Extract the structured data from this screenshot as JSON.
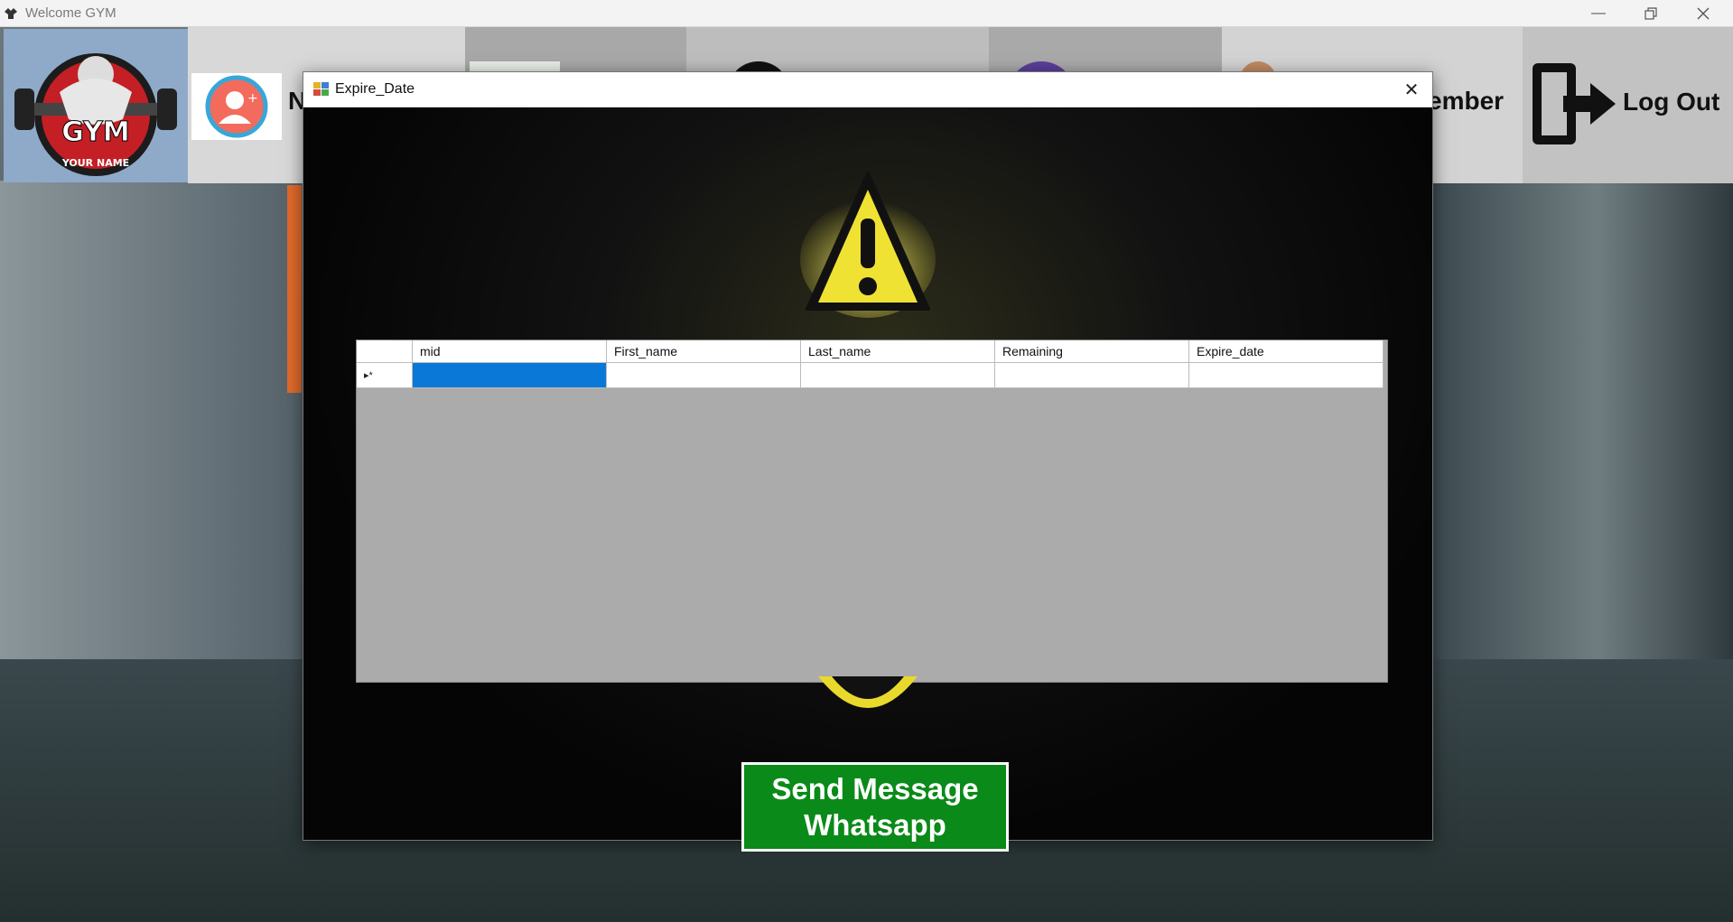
{
  "window": {
    "title": "Welcome GYM"
  },
  "toolbar": {
    "logo_text": "GYM",
    "logo_subtext": "YOUR NAME",
    "partial_label_left": "N",
    "partial_label_right": "ember",
    "logout_label": "Log Out"
  },
  "dialog": {
    "title": "Expire_Date",
    "close_glyph": "✕",
    "grid": {
      "columns": [
        "mid",
        "First_name",
        "Last_name",
        "Remaining",
        "Expire_date"
      ],
      "new_row_marker": "▸*"
    },
    "send_button": {
      "line1": "Send Message",
      "line2": "Whatsapp"
    }
  },
  "colors": {
    "send_button": "#0a8a18",
    "selected_cell": "#0a78d7",
    "grid_background": "#ababab",
    "warning_yellow": "#f0e233"
  },
  "icons": [
    "app-icon",
    "minimize-icon",
    "restore-icon",
    "close-icon",
    "add-user-icon",
    "logout-icon",
    "warning-icon"
  ]
}
